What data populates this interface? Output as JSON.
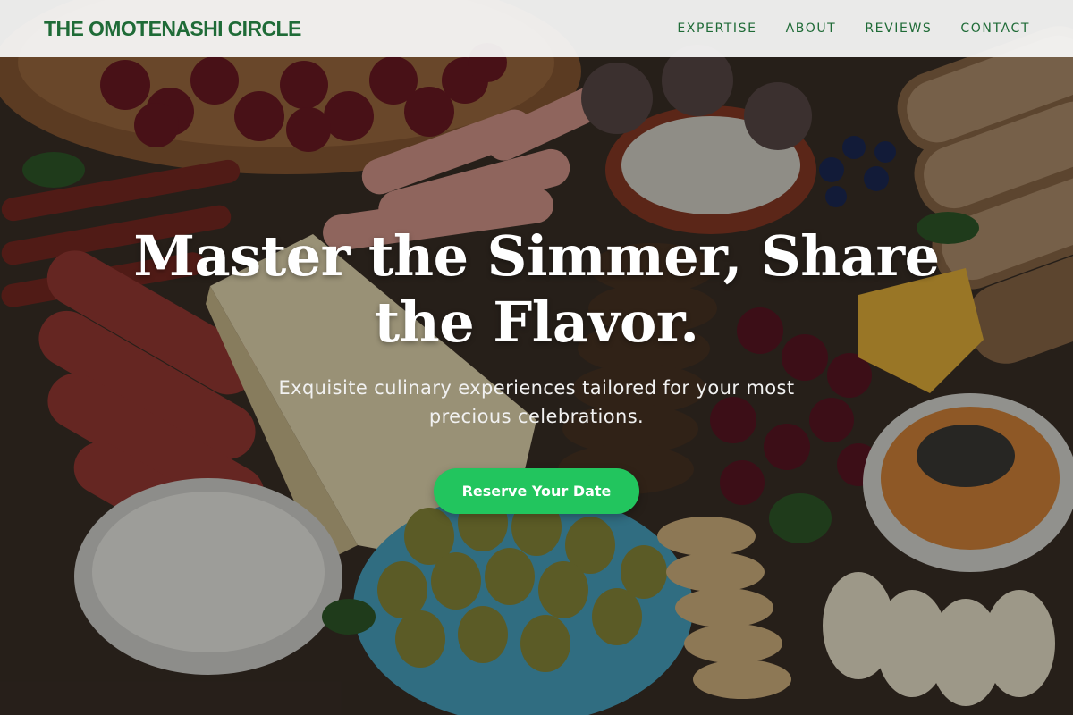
{
  "header": {
    "brand": "THE OMOTENASHI CIRCLE",
    "nav": [
      "EXPERTISE",
      "ABOUT",
      "REVIEWS",
      "CONTACT"
    ]
  },
  "hero": {
    "title": "Master the Simmer, Share the Flavor.",
    "subtitle": "Exquisite culinary experiences tailored for your most precious celebrations.",
    "cta_label": "Reserve Your Date",
    "background": "charcuterie-board-photo"
  },
  "colors": {
    "brand_green": "#1f6b37",
    "cta_green": "#22c55e",
    "header_bg": "#fafafa"
  }
}
